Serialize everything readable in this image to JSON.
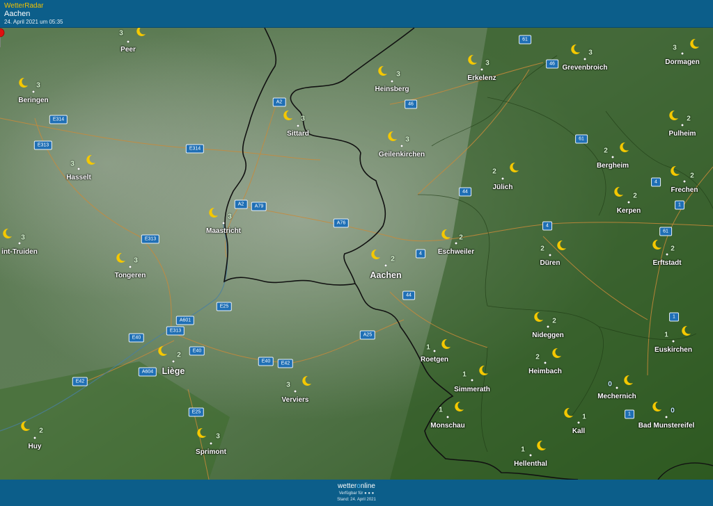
{
  "header": {
    "app_title": "WetterRadar",
    "location": "Aachen",
    "timestamp": "24. April 2021 um 05:35"
  },
  "footer": {
    "brand_prefix": "wetter",
    "brand_o": "o",
    "brand_suffix": "nline",
    "availability": "Verfügbar für ● ● ●",
    "stand": "Stand: 24. April 2021"
  },
  "map": {
    "colors": {
      "moon": "#f5c800",
      "header": "#0c5e8a",
      "border": "#111111",
      "terrain": "#3f6a30"
    },
    "cities": [
      {
        "name": "Peer",
        "value": "3",
        "icon": "moon-icon"
      },
      {
        "name": "Beringen",
        "value": "3",
        "icon": "moon-icon"
      },
      {
        "name": "Hasselt",
        "value": "3",
        "icon": "moon-icon"
      },
      {
        "name": "int-Truiden",
        "value": "3",
        "icon": "moon-icon"
      },
      {
        "name": "Tongeren",
        "value": "3",
        "icon": "moon-icon"
      },
      {
        "name": "Maastricht",
        "value": "3",
        "icon": "moon-icon"
      },
      {
        "name": "Sittard",
        "value": "3",
        "icon": "moon-icon"
      },
      {
        "name": "Heinsberg",
        "value": "3",
        "icon": "moon-icon"
      },
      {
        "name": "Erkelenz",
        "value": "3",
        "icon": "moon-icon"
      },
      {
        "name": "Grevenbroich",
        "value": "3",
        "icon": "moon-icon"
      },
      {
        "name": "Dormagen",
        "value": "3",
        "icon": "moon-icon"
      },
      {
        "name": "Geilenkirchen",
        "value": "3",
        "icon": "moon-icon"
      },
      {
        "name": "Pulheim",
        "value": "2",
        "icon": "moon-icon"
      },
      {
        "name": "Bergheim",
        "value": "2",
        "icon": "moon-icon"
      },
      {
        "name": "Jülich",
        "value": "2",
        "icon": "moon-icon"
      },
      {
        "name": "Frechen",
        "value": "2",
        "icon": "moon-icon"
      },
      {
        "name": "Kerpen",
        "value": "2",
        "icon": "moon-icon"
      },
      {
        "name": "Eschweiler",
        "value": "2",
        "icon": "moon-icon"
      },
      {
        "name": "Aachen",
        "value": "2",
        "icon": "moon-icon"
      },
      {
        "name": "Düren",
        "value": "2",
        "icon": "moon-icon"
      },
      {
        "name": "Erftstadt",
        "value": "2",
        "icon": "moon-icon"
      },
      {
        "name": "Nideggen",
        "value": "2",
        "icon": "moon-icon"
      },
      {
        "name": "Euskirchen",
        "value": "1",
        "icon": "moon-icon"
      },
      {
        "name": "Roetgen",
        "value": "1",
        "icon": "moon-icon"
      },
      {
        "name": "Heimbach",
        "value": "2",
        "icon": "moon-icon"
      },
      {
        "name": "Simmerath",
        "value": "1",
        "icon": "moon-icon"
      },
      {
        "name": "Mechernich",
        "value": "0",
        "icon": "moon-icon"
      },
      {
        "name": "Liège",
        "value": "2",
        "icon": "moon-icon"
      },
      {
        "name": "Verviers",
        "value": "3",
        "icon": "moon-icon"
      },
      {
        "name": "Monschau",
        "value": "1",
        "icon": "moon-icon"
      },
      {
        "name": "Bad Munstereifel",
        "value": "0",
        "icon": "moon-icon"
      },
      {
        "name": "Kall",
        "value": "1",
        "icon": "moon-icon"
      },
      {
        "name": "Huy",
        "value": "2",
        "icon": "moon-icon"
      },
      {
        "name": "Sprimont",
        "value": "3",
        "icon": "moon-icon"
      },
      {
        "name": "Hellenthal",
        "value": "1",
        "icon": "moon-icon"
      }
    ],
    "roads": [
      "61",
      "46",
      "A2",
      "E314",
      "E313",
      "E314",
      "46",
      "44",
      "61",
      "4",
      "1",
      "A2",
      "A79",
      "A76",
      "E313",
      "4",
      "4",
      "61",
      "1",
      "E25",
      "A601",
      "E313",
      "E40",
      "A25",
      "E40",
      "E40",
      "E42",
      "A604",
      "E42",
      "44",
      "E25",
      "1",
      "1"
    ]
  }
}
